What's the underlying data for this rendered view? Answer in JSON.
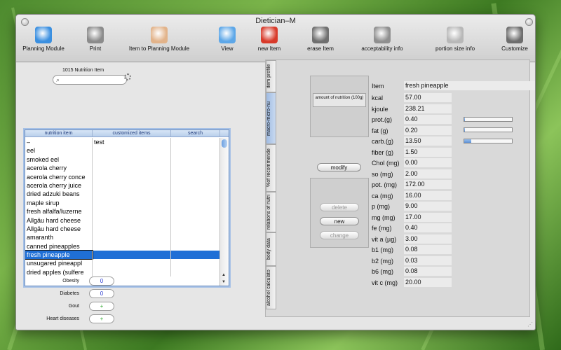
{
  "window": {
    "title": "Dietician–M"
  },
  "toolbar": [
    {
      "label": "Planning Module",
      "icon": "pie-chart-icon",
      "color": "#3a8fe0"
    },
    {
      "label": "Print",
      "icon": "printer-icon",
      "color": "#8b8b8b"
    },
    {
      "label": "Item to Planning Module",
      "icon": "hand-icon",
      "color": "#e2b38a"
    },
    {
      "label": "View",
      "icon": "monitor-icon",
      "color": "#5da7e8"
    },
    {
      "label": "new Item",
      "icon": "new-item-icon",
      "color": "#d83a2a"
    },
    {
      "label": "erase Item",
      "icon": "trash-icon",
      "color": "#6f6f6f"
    },
    {
      "label": "acceptability info",
      "icon": "question-icon",
      "color": "#8f8f8f"
    },
    {
      "label": "portion size info",
      "icon": "glass-icon",
      "color": "#b8b8b8"
    },
    {
      "label": "Customize",
      "icon": "gear-icon",
      "color": "#6d6d6d"
    }
  ],
  "search": {
    "item_code": "1015   Nutrition Item",
    "value": ""
  },
  "list": {
    "columns": [
      "nutrition item",
      "customized items",
      "search"
    ],
    "rows": [
      {
        "name": "–",
        "custom": "test"
      },
      {
        "name": "eel",
        "custom": ""
      },
      {
        "name": "smoked eel",
        "custom": ""
      },
      {
        "name": "acerola cherry",
        "custom": ""
      },
      {
        "name": "acerola cherry conce",
        "custom": ""
      },
      {
        "name": "acerola cherry juice",
        "custom": ""
      },
      {
        "name": "dried adzuki beans",
        "custom": ""
      },
      {
        "name": "maple sirup",
        "custom": ""
      },
      {
        "name": "fresh alfalfa/luzerne",
        "custom": ""
      },
      {
        "name": "Allgäu hard cheese",
        "custom": ""
      },
      {
        "name": "Allgäu hard cheese",
        "custom": ""
      },
      {
        "name": "amaranth",
        "custom": ""
      },
      {
        "name": "canned pineapples",
        "custom": ""
      },
      {
        "name": "fresh pineapple",
        "custom": "",
        "selected": true
      },
      {
        "name": "unsugared pineappl",
        "custom": ""
      },
      {
        "name": "dried apples (sulfere",
        "custom": ""
      }
    ]
  },
  "risks": [
    {
      "label": "Obesity",
      "value": "0"
    },
    {
      "label": "Diabetes",
      "value": "0"
    },
    {
      "label": "Gout",
      "value": "+"
    },
    {
      "label": "Heart diseases",
      "value": "+"
    }
  ],
  "tabs": [
    "item profile",
    "macro-micro-nu",
    "%of recommende",
    "relations of nutri",
    "body data",
    "alcohol calculato"
  ],
  "detail": {
    "amount_label": "amount of nutrition (100g)",
    "modify": "modify",
    "delete": "delete",
    "new": "new",
    "change": "change",
    "item_label": "Item",
    "item_value": "fresh pineapple",
    "nutrients": [
      {
        "label": "kcal",
        "value": "57.00"
      },
      {
        "label": "kjoule",
        "value": "238.21"
      },
      {
        "label": "prot.(g)",
        "value": "0.40"
      },
      {
        "label": "fat   (g)",
        "value": "0.20"
      },
      {
        "label": "carb.(g)",
        "value": "13.50"
      },
      {
        "label": "fiber (g)",
        "value": "1.50"
      },
      {
        "label": "Chol (mg)",
        "value": "0.00"
      },
      {
        "label": "so    (mg)",
        "value": "2.00"
      },
      {
        "label": "pot.  (mg)",
        "value": "172.00"
      },
      {
        "label": "ca    (mg)",
        "value": "16.00"
      },
      {
        "label": "p      (mg)",
        "value": "9.00"
      },
      {
        "label": "mg   (mg)",
        "value": "17.00"
      },
      {
        "label": "fe     (mg)",
        "value": "0.40"
      },
      {
        "label": "vit a  (µg)",
        "value": "3.00"
      },
      {
        "label": "b1     (mg)",
        "value": "0.08"
      },
      {
        "label": "b2     (mg)",
        "value": "0.03"
      },
      {
        "label": "b6     (mg)",
        "value": "0.08"
      },
      {
        "label": "vit c (mg)",
        "value": "20.00"
      }
    ],
    "macro_bars": [
      {
        "label": "prot.(g)",
        "fraction": 0.01
      },
      {
        "label": "fat   (g)",
        "fraction": 0.01
      },
      {
        "label": "carb.(g)",
        "fraction": 0.14
      }
    ]
  }
}
